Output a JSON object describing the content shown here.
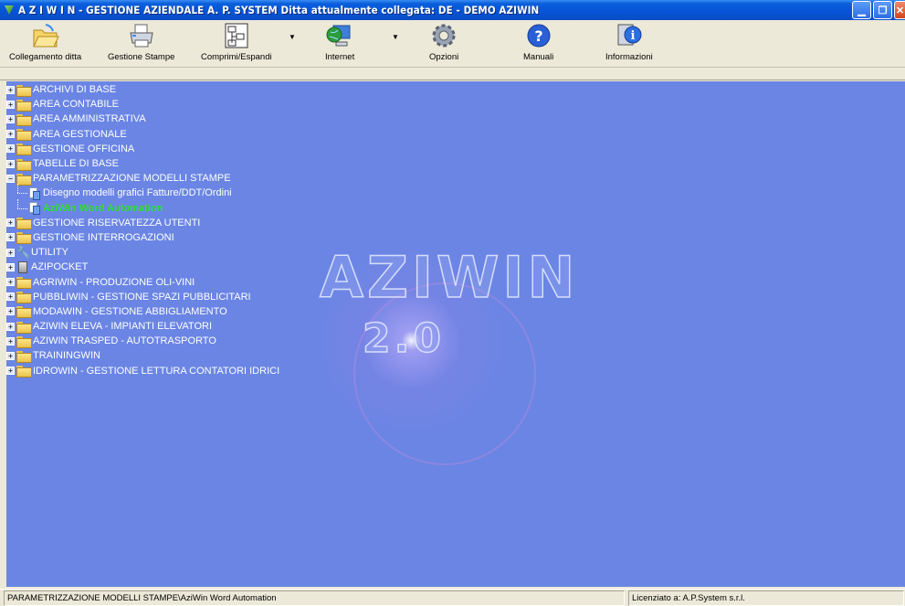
{
  "window": {
    "title": "A Z I W I N - GESTIONE AZIENDALE A. P. SYSTEM   Ditta attualmente collegata: DE - DEMO AZIWIN",
    "controls": [
      "minimize",
      "restore",
      "close"
    ]
  },
  "toolbar": {
    "items": [
      {
        "label": "Collegamento ditta",
        "icon": "folder-open-icon"
      },
      {
        "label": "Gestione Stampe",
        "icon": "printer-icon"
      },
      {
        "label": "Comprimi/Espandi",
        "icon": "tree-structure-icon"
      },
      {
        "label": "Internet",
        "icon": "globe-computer-icon"
      },
      {
        "label": "Opzioni",
        "icon": "gear-icon"
      },
      {
        "label": "Manuali",
        "icon": "help-icon"
      },
      {
        "label": "Informazioni",
        "icon": "info-computer-icon"
      }
    ]
  },
  "logo": {
    "name": "AZIWIN",
    "version": "2.0"
  },
  "tree": {
    "nodes": [
      {
        "label": "ARCHIVI DI BASE",
        "expanded": false,
        "icon": "folder-icon"
      },
      {
        "label": "AREA CONTABILE",
        "expanded": false,
        "icon": "folder-icon"
      },
      {
        "label": "AREA AMMINISTRATIVA",
        "expanded": false,
        "icon": "folder-icon"
      },
      {
        "label": "AREA GESTIONALE",
        "expanded": false,
        "icon": "folder-icon"
      },
      {
        "label": "GESTIONE OFFICINA",
        "expanded": false,
        "icon": "folder-icon"
      },
      {
        "label": "TABELLE DI BASE",
        "expanded": false,
        "icon": "folder-icon"
      },
      {
        "label": "PARAMETRIZZAZIONE MODELLI STAMPE",
        "expanded": true,
        "icon": "folder-icon",
        "children": [
          {
            "label": "Disegno modelli grafici Fatture/DDT/Ordini",
            "selected": false
          },
          {
            "label": "AziWin Word Automation",
            "selected": true
          }
        ]
      },
      {
        "label": "GESTIONE RISERVATEZZA UTENTI",
        "expanded": false,
        "icon": "folder-icon"
      },
      {
        "label": "GESTIONE INTERROGAZIONI",
        "expanded": false,
        "icon": "folder-icon"
      },
      {
        "label": "UTILITY",
        "expanded": false,
        "icon": "tools-icon"
      },
      {
        "label": "AZIPOCKET",
        "expanded": false,
        "icon": "pocket-device-icon"
      },
      {
        "label": "AGRIWIN - PRODUZIONE OLI-VINI",
        "expanded": false,
        "icon": "folder-icon"
      },
      {
        "label": "PUBBLIWIN - GESTIONE SPAZI PUBBLICITARI",
        "expanded": false,
        "icon": "folder-icon"
      },
      {
        "label": "MODAWIN - GESTIONE ABBIGLIAMENTO",
        "expanded": false,
        "icon": "folder-icon"
      },
      {
        "label": "AZIWIN ELEVA - IMPIANTI ELEVATORI",
        "expanded": false,
        "icon": "folder-icon"
      },
      {
        "label": "AZIWIN TRASPED - AUTOTRASPORTO",
        "expanded": false,
        "icon": "folder-icon"
      },
      {
        "label": "TRAININGWIN",
        "expanded": false,
        "icon": "folder-icon"
      },
      {
        "label": "IDROWIN - GESTIONE LETTURA CONTATORI IDRICI",
        "expanded": false,
        "icon": "folder-icon"
      }
    ]
  },
  "statusbar": {
    "path": "PARAMETRIZZAZIONE MODELLI STAMPE\\AziWin Word Automation",
    "license": "Licenziato a: A.P.System s.r.l."
  },
  "colors": {
    "background": "#6a85e4",
    "titlebar": "#0653d6",
    "selected_text": "#2fe02f"
  }
}
